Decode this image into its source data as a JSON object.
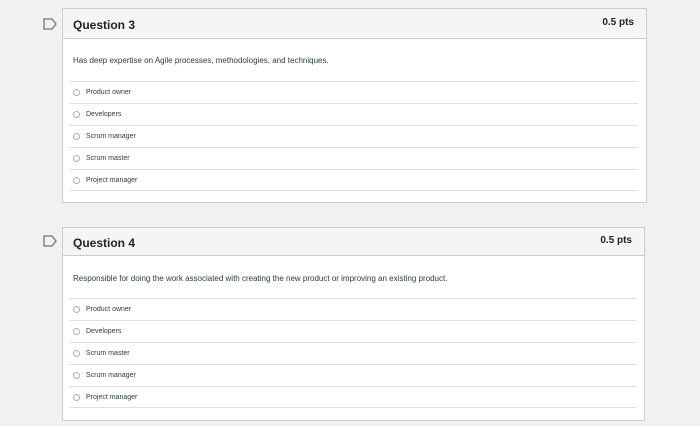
{
  "questions": [
    {
      "title": "Question 3",
      "points": "0.5 pts",
      "text": "Has deep expertise on Agile processes, methodologies, and techniques.",
      "answers": [
        "Product owner",
        "Developers",
        "Scrum manager",
        "Scrum master",
        "Project manager"
      ]
    },
    {
      "title": "Question 4",
      "points": "0.5 pts",
      "text": "Responsible for doing the work associated with creating the new product or improving an existing product.",
      "answers": [
        "Product owner",
        "Developers",
        "Scrum master",
        "Scrum manager",
        "Project manager"
      ]
    }
  ],
  "colors": {
    "page_background": "#f1f1ef",
    "card_header": "#f5f5f5",
    "card_border": "#c7cdd1",
    "text": "#2d3b45"
  },
  "icons": [
    "flag-question-icon",
    "radio-button-icon"
  ]
}
